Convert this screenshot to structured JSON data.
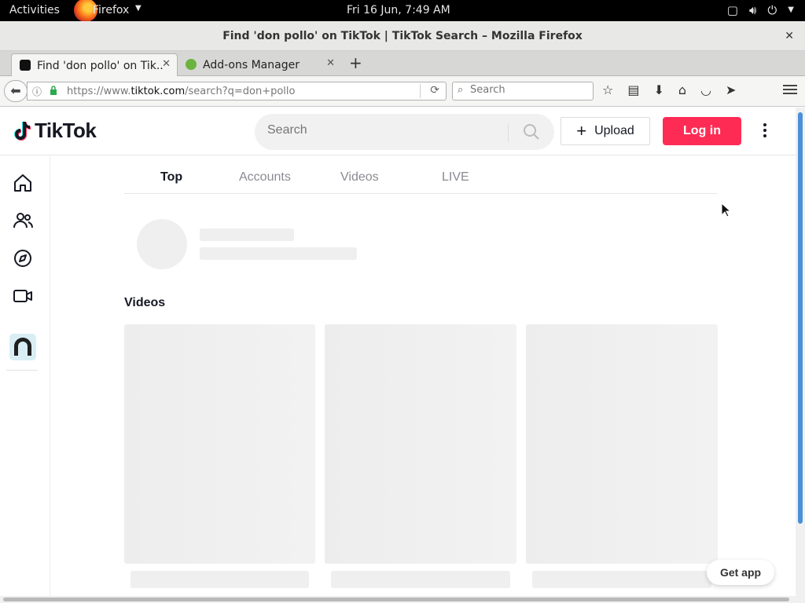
{
  "system_bar": {
    "activities": "Activities",
    "app_name": "Firefox",
    "clock": "Fri 16 Jun,  7:49 AM"
  },
  "window": {
    "title": "Find 'don pollo' on TikTok | TikTok Search – Mozilla Firefox"
  },
  "tabs": [
    {
      "label": "Find 'don pollo' on Tik...",
      "active": true
    },
    {
      "label": "Add-ons Manager",
      "active": false
    }
  ],
  "navbar": {
    "url_prefix": "https://www.",
    "url_domain": "tiktok.com",
    "url_path": "/search?q=don+pollo",
    "search_placeholder": "Search"
  },
  "tiktok": {
    "logo_text": "TikTok",
    "search_placeholder": "Search",
    "upload_label": "Upload",
    "login_label": "Log in",
    "brand_color": "#fe2c55",
    "sidebar": [
      "home-icon",
      "following-icon",
      "explore-icon",
      "live-icon",
      "profile-avatar"
    ],
    "search_tabs": [
      {
        "label": "Top",
        "active": true
      },
      {
        "label": "Accounts",
        "active": false
      },
      {
        "label": "Videos",
        "active": false
      },
      {
        "label": "LIVE",
        "active": false
      }
    ],
    "videos_heading": "Videos",
    "get_app_label": "Get app"
  }
}
